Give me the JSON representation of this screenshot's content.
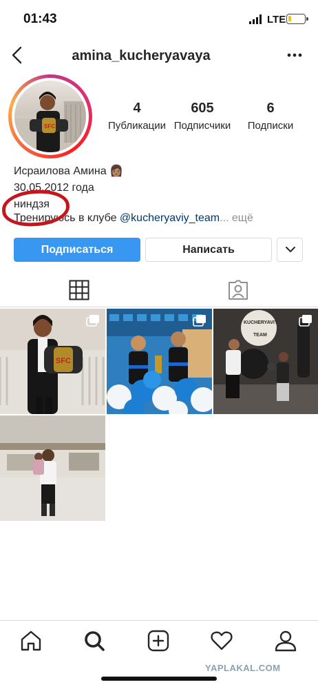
{
  "status_bar": {
    "time": "01:43",
    "network": "LTE",
    "battery_level": 0.2,
    "battery_color": "#f0c419"
  },
  "header": {
    "username": "amina_kucheryavaya",
    "back_icon": "chevron-left-icon",
    "more_icon": "ellipsis-icon"
  },
  "profile": {
    "stats": [
      {
        "value": "4",
        "label": "Публикации"
      },
      {
        "value": "605",
        "label": "Подписчики"
      },
      {
        "value": "6",
        "label": "Подписки"
      }
    ],
    "bio": {
      "name": "Исраилова Амина 👩🏽",
      "date": "30.05.2012 года",
      "ninja": "ниндзя",
      "line_prefix": "Тренируюсь в клубе ",
      "mention": "@kucheryaviy_team",
      "more": "... ещё"
    }
  },
  "actions": {
    "follow": "Подписаться",
    "message": "Написать",
    "dropdown_icon": "chevron-down-icon",
    "accent_color": "#3897f0"
  },
  "tabs": [
    {
      "icon": "grid-icon",
      "active": true
    },
    {
      "icon": "tagged-person-icon",
      "active": false
    }
  ],
  "posts": [
    {
      "icon": "carousel-icon"
    },
    {
      "icon": "carousel-icon"
    },
    {
      "icon": "carousel-icon"
    },
    {
      "icon": "none"
    }
  ],
  "bottom_nav": [
    {
      "icon": "home-icon"
    },
    {
      "icon": "search-icon"
    },
    {
      "icon": "add-post-icon"
    },
    {
      "icon": "heart-icon"
    },
    {
      "icon": "profile-icon"
    }
  ],
  "watermark": "YAPLAKAL.COM",
  "annotation_color": "#c4161c"
}
